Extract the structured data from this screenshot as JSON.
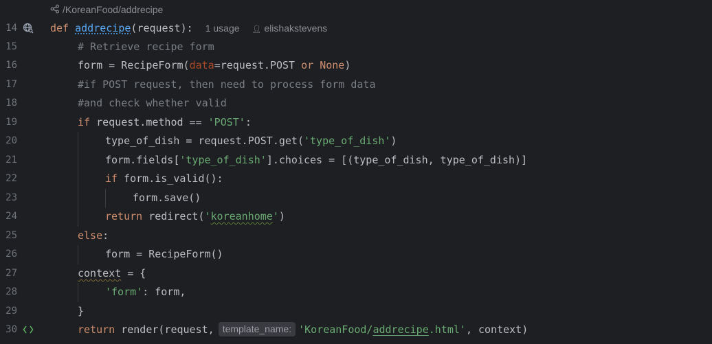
{
  "breadcrumb": {
    "path": "/KoreanFood/addrecipe",
    "icon": "share-link-icon"
  },
  "header_hints": {
    "usage": "1 usage",
    "author": "elishakstevens"
  },
  "inlay_hint": "template_name:",
  "line_numbers": [
    "14",
    "15",
    "16",
    "17",
    "18",
    "19",
    "20",
    "21",
    "22",
    "23",
    "24",
    "25",
    "26",
    "27",
    "28",
    "29",
    "30"
  ],
  "lines": {
    "l14": {
      "kw": "def",
      "fn": "addrecipe",
      "rest": "(request):"
    },
    "l15": {
      "comment": "# Retrieve recipe form"
    },
    "l16": {
      "a": "form = RecipeForm(",
      "param": "data",
      "b": "=request.POST ",
      "or": "or",
      "none": "None",
      "c": ")"
    },
    "l17": {
      "comment": "#if POST request, then need to process form data"
    },
    "l18": {
      "comment": "#and check whether valid"
    },
    "l19": {
      "kw": "if",
      "a": " request.method == ",
      "str": "'POST'",
      "b": ":"
    },
    "l20": {
      "a": "type_of_dish = request.POST.get(",
      "str": "'type_of_dish'",
      "b": ")"
    },
    "l21": {
      "a": "form.fields[",
      "str": "'type_of_dish'",
      "b": "].choices = [(type_of_dish, type_of_dish)]"
    },
    "l22": {
      "kw": "if",
      "a": " form.is_valid():"
    },
    "l23": {
      "a": "form.save()"
    },
    "l24": {
      "kw": "return",
      "a": " redirect(",
      "q1": "'",
      "str": "koreanhome",
      "q2": "'",
      "b": ")"
    },
    "l25": {
      "kw": "else",
      "a": ":"
    },
    "l26": {
      "a": "form = RecipeForm()"
    },
    "l27": {
      "var": "context",
      "a": " = {"
    },
    "l28": {
      "str": "'form'",
      "a": ": form,"
    },
    "l29": {
      "a": "}"
    },
    "l30": {
      "kw": "return",
      "a": " render(request,",
      "s1": "'KoreanFood/",
      "s2": "addrecipe",
      "s3": ".html'",
      "b": ", context)"
    }
  },
  "colors": {
    "background": "#1e1f22",
    "keyword": "#cf8e6d",
    "string": "#6aab73",
    "comment": "#7a7e85",
    "function": "#56a8f5",
    "parameter": "#aa4926"
  }
}
